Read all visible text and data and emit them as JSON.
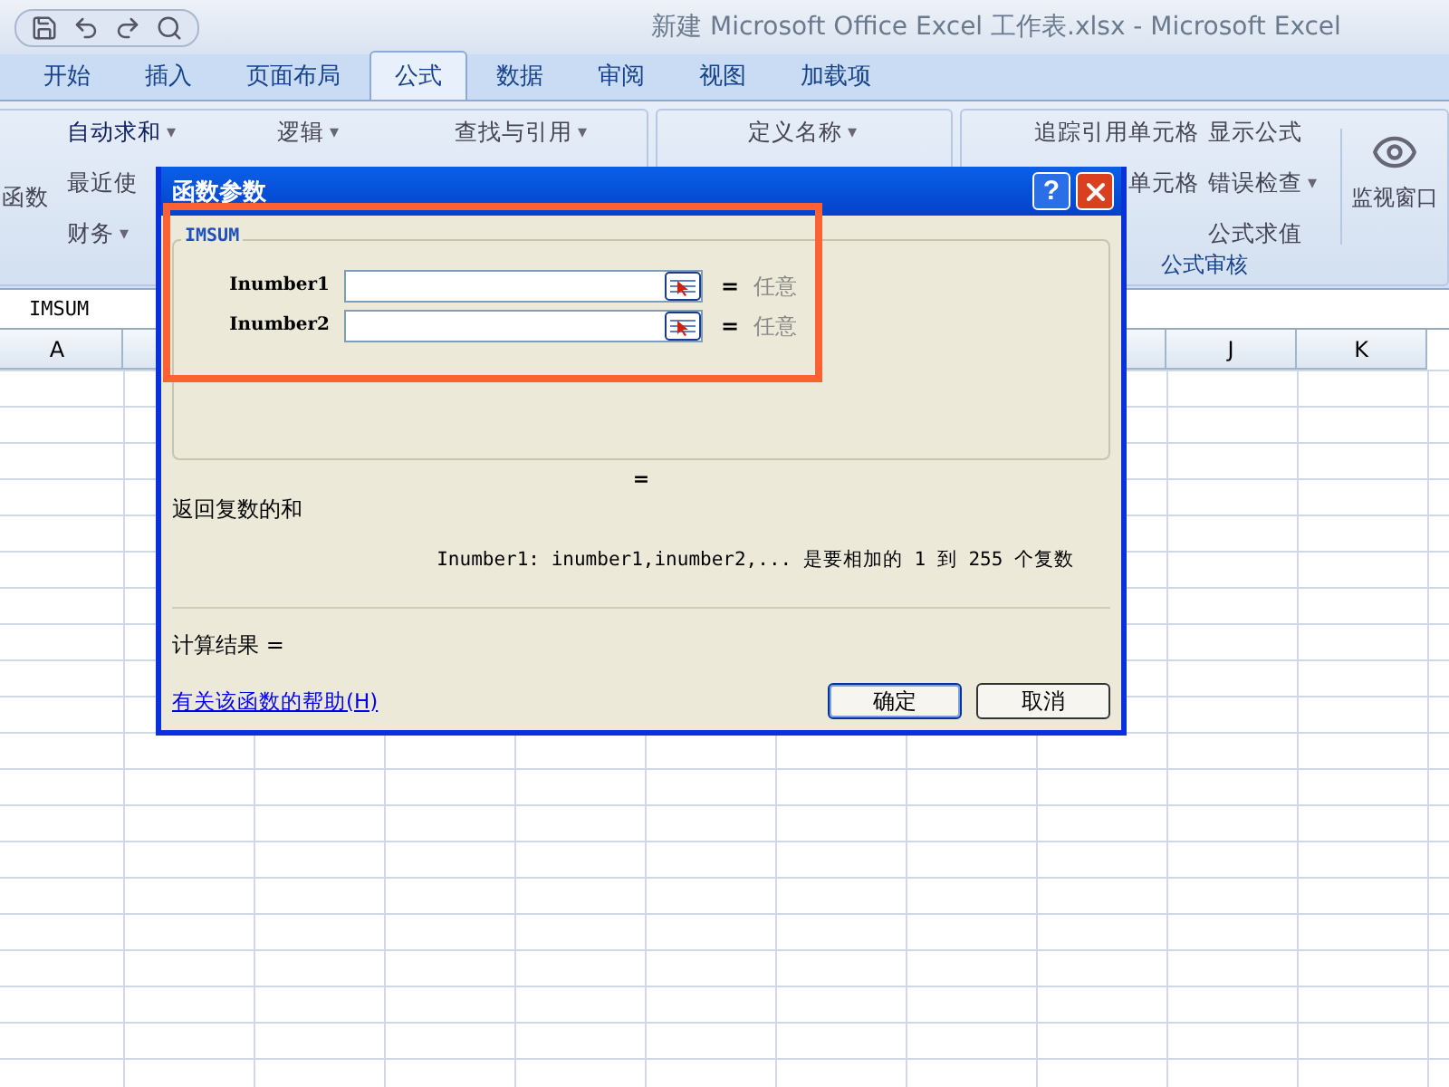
{
  "window": {
    "title": "新建 Microsoft Office Excel 工作表.xlsx - Microsoft Excel"
  },
  "tabs": [
    {
      "label": "开始",
      "selected": false
    },
    {
      "label": "插入",
      "selected": false
    },
    {
      "label": "页面布局",
      "selected": false
    },
    {
      "label": "公式",
      "selected": true
    },
    {
      "label": "数据",
      "selected": false
    },
    {
      "label": "审阅",
      "selected": false
    },
    {
      "label": "视图",
      "selected": false
    },
    {
      "label": "加载项",
      "selected": false
    }
  ],
  "ribbon": {
    "left_columns": [
      [
        {
          "label": "函数",
          "dropdown": false
        }
      ],
      [
        {
          "label": "自动求和",
          "dropdown": true
        },
        {
          "label": "最近使",
          "dropdown": false
        },
        {
          "label": "财务",
          "dropdown": true
        }
      ],
      [
        {
          "label": "逻辑",
          "dropdown": true
        }
      ],
      [
        {
          "label": "查找与引用",
          "dropdown": true
        }
      ],
      [
        {
          "label": "定义名称",
          "dropdown": true
        }
      ]
    ],
    "audit_columns": [
      [
        {
          "label": "追踪引用单元格",
          "dropdown": false
        },
        {
          "label": "单元格",
          "dropdown": false
        }
      ],
      [
        {
          "label": "显示公式",
          "dropdown": false
        },
        {
          "label": "错误检查",
          "dropdown": true
        },
        {
          "label": "公式求值",
          "dropdown": false
        }
      ]
    ],
    "watch_label": "监视窗口",
    "dropdown_glyph": "▾",
    "audit_group_label": "公式审核"
  },
  "name_box": "IMSUM",
  "columns": [
    {
      "label": "A"
    },
    {
      "label": "J"
    },
    {
      "label": "K"
    }
  ],
  "dialog": {
    "title": "函数参数",
    "help_glyph": "?",
    "function_name": "IMSUM",
    "arguments": [
      {
        "label": "Inumber1",
        "equals": "=",
        "result": "任意"
      },
      {
        "label": "Inumber2",
        "equals": "=",
        "result": "任意"
      }
    ],
    "overall_equals": "=",
    "description": "返回复数的和",
    "argument_help": {
      "label": "Inumber1:",
      "text": "inumber1,inumber2,... 是要相加的 1 到 255 个复数"
    },
    "result_label": "计算结果 =",
    "help_link": "有关该函数的帮助(H)",
    "buttons": [
      {
        "label": "确定",
        "default": true
      },
      {
        "label": "取消",
        "default": false
      }
    ]
  }
}
